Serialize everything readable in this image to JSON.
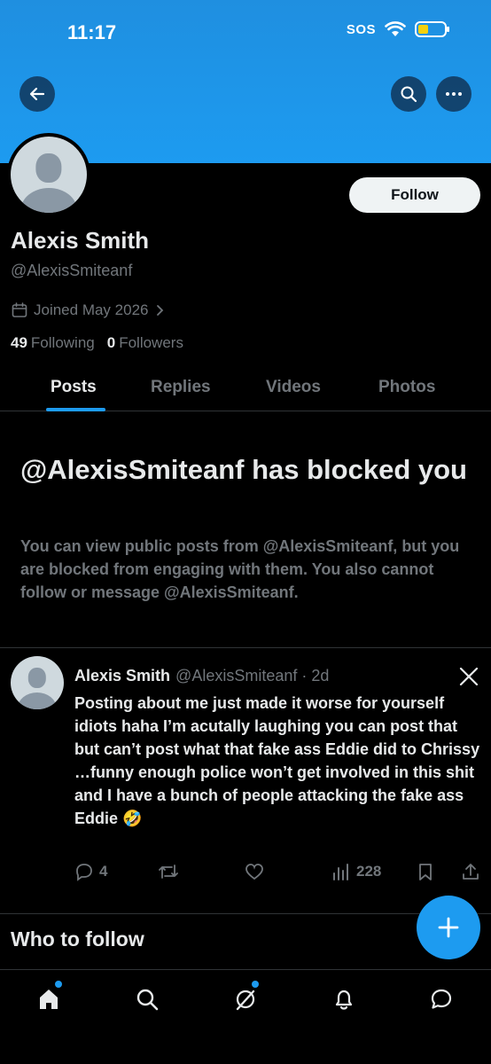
{
  "status_bar": {
    "time": "11:17",
    "sos": "SOS",
    "battery_color": "#f5d10a"
  },
  "header": {
    "banner_color": "#1d9bf0",
    "back_icon": "back-arrow-icon",
    "search_icon": "search-icon",
    "more_icon": "more-icon"
  },
  "profile": {
    "name": "Alexis Smith",
    "handle": "@AlexisSmiteanf",
    "joined": "Joined May 2026",
    "following_count": "49",
    "following_label": "Following",
    "followers_count": "0",
    "followers_label": "Followers",
    "follow_button": "Follow"
  },
  "tabs": [
    {
      "label": "Posts",
      "active": true
    },
    {
      "label": "Replies",
      "active": false
    },
    {
      "label": "Videos",
      "active": false
    },
    {
      "label": "Photos",
      "active": false
    }
  ],
  "blocked": {
    "title": "@AlexisSmiteanf has blocked you",
    "text": "You can view public posts from @AlexisSmiteanf, but you are blocked from engaging with them. You also cannot follow or message @AlexisSmiteanf."
  },
  "post": {
    "author": "Alexis Smith",
    "meta": "@AlexisSmiteanf · 2d",
    "body": "Posting about me just made it worse for yourself idiots haha I’m acutally laughing you can post that but can’t post what that fake ass Eddie did to Chrissy …funny enough police won’t get involved in this shit and I have a bunch of people attacking the fake ass Eddie 🤣",
    "replies": "4",
    "views": "228"
  },
  "who_to_follow": "Who to follow",
  "accent_color": "#1d9bf0"
}
